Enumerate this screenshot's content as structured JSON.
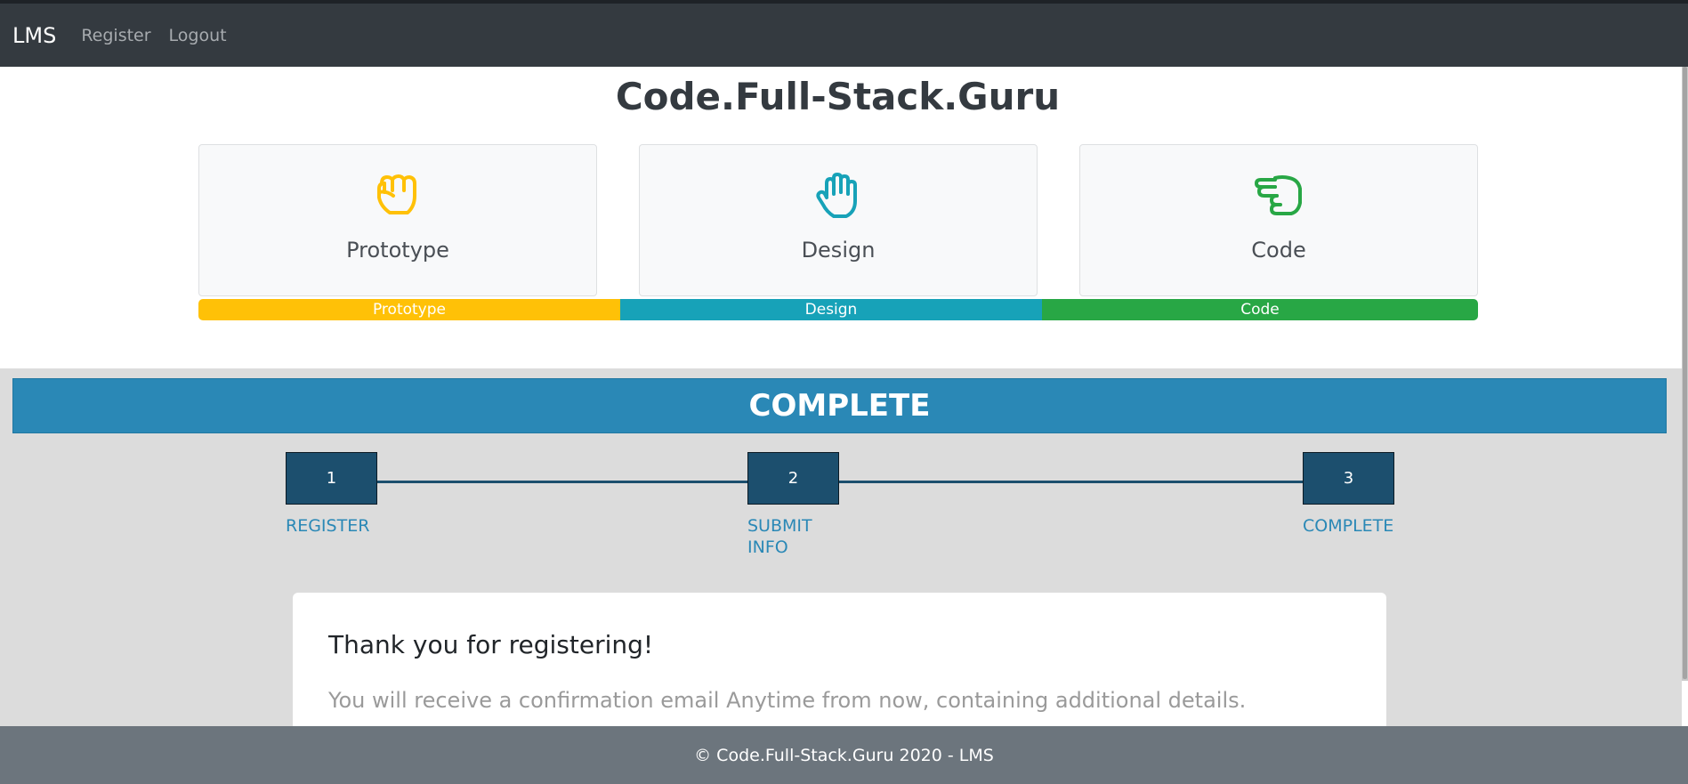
{
  "navbar": {
    "brand": "LMS",
    "links": [
      "Register",
      "Logout"
    ]
  },
  "header": {
    "title": "Code.Full-Stack.Guru"
  },
  "cards": [
    {
      "label": "Prototype",
      "icon": "hand-rock-icon",
      "color": "#ffc107"
    },
    {
      "label": "Design",
      "icon": "hand-paper-icon",
      "color": "#17a2b8"
    },
    {
      "label": "Code",
      "icon": "hand-pointing-icon",
      "color": "#28a745"
    }
  ],
  "progress": {
    "segments": [
      {
        "label": "Prototype",
        "color": "#ffc107",
        "percent": 33
      },
      {
        "label": "Design",
        "color": "#17a2b8",
        "percent": 33
      },
      {
        "label": "Code",
        "color": "#28a745",
        "percent": 34
      }
    ]
  },
  "banner": {
    "title": "COMPLETE",
    "color": "#2a88b6"
  },
  "stepper": {
    "steps": [
      {
        "number": "1",
        "label": "REGISTER"
      },
      {
        "number": "2",
        "label": "SUBMIT INFO"
      },
      {
        "number": "3",
        "label": "COMPLETE"
      }
    ]
  },
  "confirmation": {
    "heading": "Thank you for registering!",
    "message": "You will receive a confirmation email Anytime from now, containing additional details."
  },
  "footer": {
    "text": "© Code.Full-Stack.Guru 2020 - LMS"
  }
}
